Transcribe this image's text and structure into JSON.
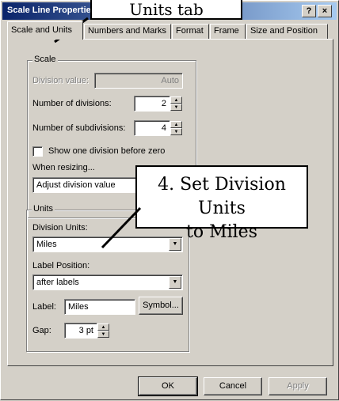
{
  "dialog": {
    "title": "Scale Line Properties",
    "help_label": "?",
    "close_label": "×"
  },
  "tabs": [
    {
      "label": "Scale and Units",
      "active": true
    },
    {
      "label": "Numbers and Marks"
    },
    {
      "label": "Format"
    },
    {
      "label": "Frame"
    },
    {
      "label": "Size and Position"
    }
  ],
  "scale_group": {
    "title": "Scale",
    "division_value_label": "Division value:",
    "division_value": "Auto",
    "num_divisions_label": "Number of divisions:",
    "num_divisions": "2",
    "num_subdivisions_label": "Number of subdivisions:",
    "num_subdivisions": "4",
    "show_one_division_label": "Show one division before zero",
    "show_one_division_checked": false,
    "when_resizing_label": "When resizing...",
    "when_resizing_value": "Adjust division value"
  },
  "units_group": {
    "title": "Units",
    "division_units_label": "Division Units:",
    "division_units_value": "Miles",
    "label_position_label": "Label Position:",
    "label_position_value": "after labels",
    "label_label": "Label:",
    "label_value": "Miles",
    "symbol_button": "Symbol...",
    "gap_label": "Gap:",
    "gap_value": "3 pt"
  },
  "buttons": {
    "ok": "OK",
    "cancel": "Cancel",
    "apply": "Apply"
  },
  "annotations": {
    "top": "Units tab",
    "main_line1": "4. Set Division Units",
    "main_line2": "to Miles"
  }
}
